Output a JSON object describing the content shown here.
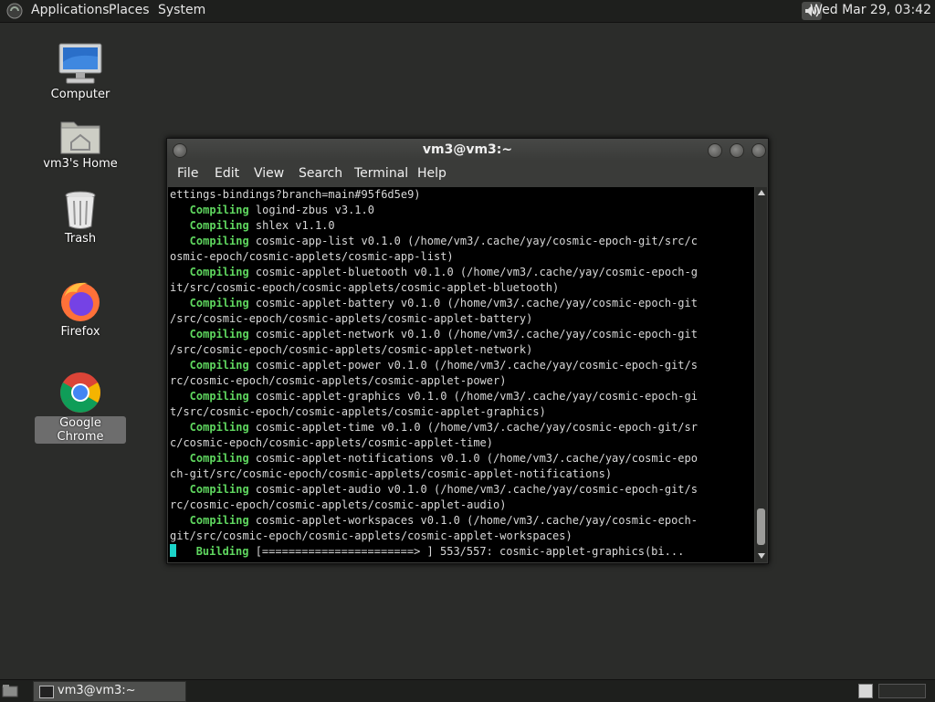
{
  "top_panel": {
    "menus": [
      "Applications",
      "Places",
      "System"
    ],
    "clock": "Wed Mar 29, 03:42"
  },
  "desktop_icons": [
    {
      "label": "Computer"
    },
    {
      "label": "vm3's Home"
    },
    {
      "label": "Trash"
    },
    {
      "label": "Firefox"
    },
    {
      "label": "Google Chrome"
    }
  ],
  "terminal": {
    "title": "vm3@vm3:~",
    "menus": [
      "File",
      "Edit",
      "View",
      "Search",
      "Terminal",
      "Help"
    ],
    "lines": [
      {
        "kw": "",
        "text": "ettings-bindings?branch=main#95f6d5e9)"
      },
      {
        "kw": "   Compiling",
        "text": " logind-zbus v3.1.0"
      },
      {
        "kw": "   Compiling",
        "text": " shlex v1.1.0"
      },
      {
        "kw": "   Compiling",
        "text": " cosmic-app-list v0.1.0 (/home/vm3/.cache/yay/cosmic-epoch-git/src/c"
      },
      {
        "kw": "",
        "text": "osmic-epoch/cosmic-applets/cosmic-app-list)"
      },
      {
        "kw": "   Compiling",
        "text": " cosmic-applet-bluetooth v0.1.0 (/home/vm3/.cache/yay/cosmic-epoch-g"
      },
      {
        "kw": "",
        "text": "it/src/cosmic-epoch/cosmic-applets/cosmic-applet-bluetooth)"
      },
      {
        "kw": "   Compiling",
        "text": " cosmic-applet-battery v0.1.0 (/home/vm3/.cache/yay/cosmic-epoch-git"
      },
      {
        "kw": "",
        "text": "/src/cosmic-epoch/cosmic-applets/cosmic-applet-battery)"
      },
      {
        "kw": "   Compiling",
        "text": " cosmic-applet-network v0.1.0 (/home/vm3/.cache/yay/cosmic-epoch-git"
      },
      {
        "kw": "",
        "text": "/src/cosmic-epoch/cosmic-applets/cosmic-applet-network)"
      },
      {
        "kw": "   Compiling",
        "text": " cosmic-applet-power v0.1.0 (/home/vm3/.cache/yay/cosmic-epoch-git/s"
      },
      {
        "kw": "",
        "text": "rc/cosmic-epoch/cosmic-applets/cosmic-applet-power)"
      },
      {
        "kw": "   Compiling",
        "text": " cosmic-applet-graphics v0.1.0 (/home/vm3/.cache/yay/cosmic-epoch-gi"
      },
      {
        "kw": "",
        "text": "t/src/cosmic-epoch/cosmic-applets/cosmic-applet-graphics)"
      },
      {
        "kw": "   Compiling",
        "text": " cosmic-applet-time v0.1.0 (/home/vm3/.cache/yay/cosmic-epoch-git/sr"
      },
      {
        "kw": "",
        "text": "c/cosmic-epoch/cosmic-applets/cosmic-applet-time)"
      },
      {
        "kw": "   Compiling",
        "text": " cosmic-applet-notifications v0.1.0 (/home/vm3/.cache/yay/cosmic-epo"
      },
      {
        "kw": "",
        "text": "ch-git/src/cosmic-epoch/cosmic-applets/cosmic-applet-notifications)"
      },
      {
        "kw": "   Compiling",
        "text": " cosmic-applet-audio v0.1.0 (/home/vm3/.cache/yay/cosmic-epoch-git/s"
      },
      {
        "kw": "",
        "text": "rc/cosmic-epoch/cosmic-applets/cosmic-applet-audio)"
      },
      {
        "kw": "   Compiling",
        "text": " cosmic-applet-workspaces v0.1.0 (/home/vm3/.cache/yay/cosmic-epoch-"
      },
      {
        "kw": "",
        "text": "git/src/cosmic-epoch/cosmic-applets/cosmic-applet-workspaces)"
      }
    ],
    "building_kw": "Building",
    "building_text": " [=======================> ] 553/557: cosmic-applet-graphics(bi..."
  },
  "taskbar": {
    "task_label": "vm3@vm3:~"
  },
  "colors": {
    "keyword": "#5fd75f",
    "cursor": "#1bd3c8"
  }
}
